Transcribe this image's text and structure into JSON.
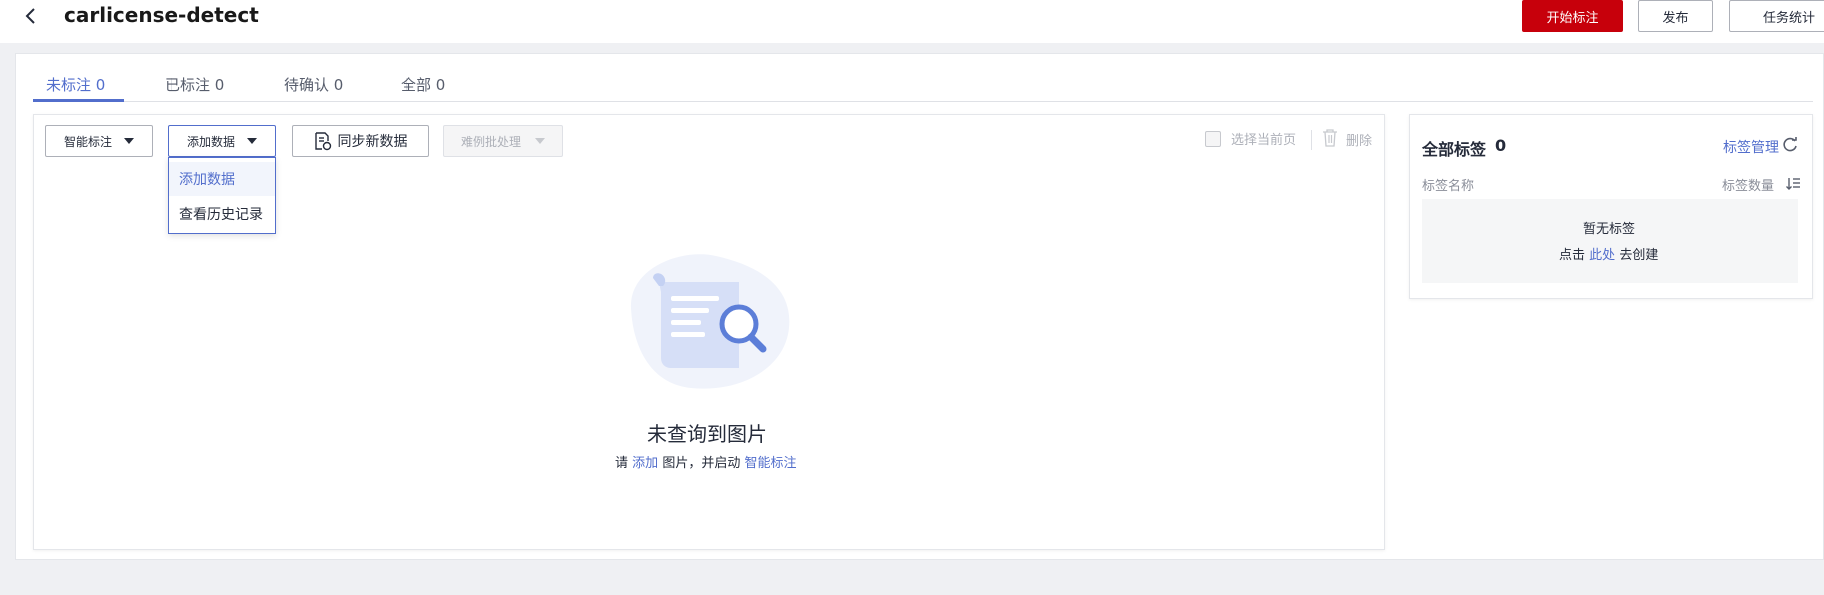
{
  "header": {
    "title": "carlicense-detect",
    "buttons": {
      "start": "开始标注",
      "publish": "发布",
      "stats": "任务统计"
    }
  },
  "tabs": [
    {
      "label": "未标注 0",
      "active": true
    },
    {
      "label": "已标注 0"
    },
    {
      "label": "待确认 0"
    },
    {
      "label": "全部 0"
    }
  ],
  "toolbar": {
    "smart_label": "智能标注",
    "add_data": "添加数据",
    "sync": "同步新数据",
    "batch": "难例批处理",
    "select_page": "选择当前页",
    "delete": "删除"
  },
  "dropdown": {
    "items": [
      "添加数据",
      "查看历史记录"
    ]
  },
  "empty": {
    "title": "未查询到图片",
    "sub_prefix": "请",
    "sub_link_add": "添加",
    "sub_middle": "图片，并启动",
    "sub_link_smart": "智能标注"
  },
  "labels_panel": {
    "title": "全部标签",
    "count": "0",
    "manage": "标签管理",
    "col_name": "标签名称",
    "col_count": "标签数量",
    "empty_text": "暂无标签",
    "create_prefix": "点击",
    "create_link": "此处",
    "create_suffix": "去创建"
  },
  "colors": {
    "accent": "#526ecc",
    "primary_red": "#c7000b"
  }
}
